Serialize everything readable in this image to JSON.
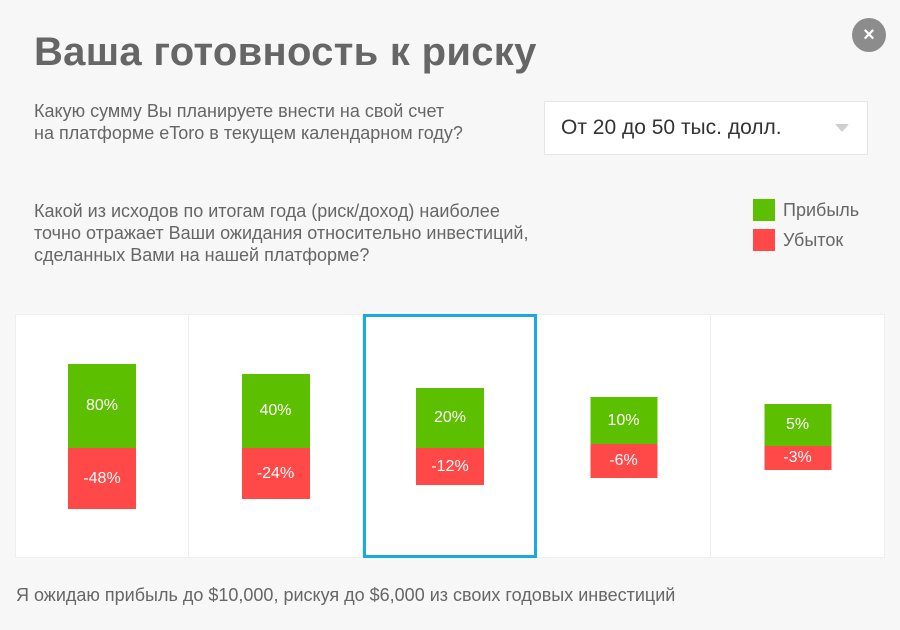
{
  "dialog": {
    "title": "Ваша готовность к риску",
    "close_label": "×",
    "close_icon": "close-icon"
  },
  "question1": {
    "line1": "Какую сумму Вы планируете внести на свой счет",
    "line2": "на платформе eToro в текущем календарном году?"
  },
  "amount_select": {
    "value": "От 20 до 50 тыс. долл.",
    "arrow_icon": "chevron-down-icon"
  },
  "question2": {
    "line1": "Какой из исходов по итогам года (риск/доход) наиболее",
    "line2": "точно отражает Ваши ожидания относительно инвестиций,",
    "line3": "сделанных Вами на нашей платформе?"
  },
  "legend": {
    "profit_label": "Прибыль",
    "loss_label": "Убыток",
    "profit_color": "#5cc000",
    "loss_color": "#ff4848"
  },
  "options": [
    {
      "profit": "80%",
      "loss": "-48%"
    },
    {
      "profit": "40%",
      "loss": "-24%"
    },
    {
      "profit": "20%",
      "loss": "-12%"
    },
    {
      "profit": "10%",
      "loss": "-6%"
    },
    {
      "profit": "5%",
      "loss": "-3%"
    }
  ],
  "selected_option_index": 2,
  "selection_color": "#1ba9e1",
  "summary": "Я ожидаю прибыль до $10,000, рискуя до $6,000 из своих годовых инвестиций"
}
